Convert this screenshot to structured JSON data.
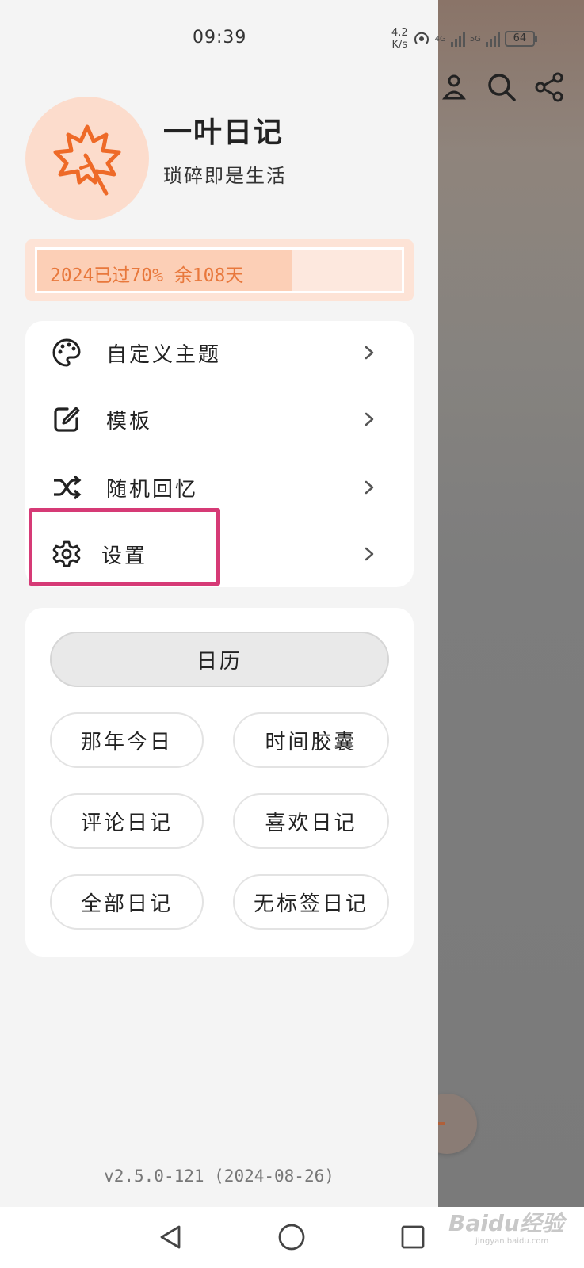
{
  "status_bar": {
    "time": "09:39",
    "speed_value": "4.2",
    "speed_unit": "K/s",
    "net1": "4G",
    "net2": "5G",
    "battery": "64"
  },
  "app": {
    "title": "一叶日记",
    "subtitle": "琐碎即是生活"
  },
  "year_progress": {
    "text": "2024已过70% 余108天",
    "fraction": 0.7
  },
  "menu": {
    "items": [
      {
        "label": "自定义主题",
        "icon": "palette-icon"
      },
      {
        "label": "模板",
        "icon": "edit-icon"
      },
      {
        "label": "随机回忆",
        "icon": "shuffle-icon"
      },
      {
        "label": "设置",
        "icon": "gear-icon"
      }
    ],
    "highlight_color": "#d63a76"
  },
  "buttons": {
    "calendar": "日历",
    "on_this_day": "那年今日",
    "time_capsule": "时间胶囊",
    "commented": "评论日记",
    "liked": "喜欢日记",
    "all": "全部日记",
    "untagged": "无标签日记"
  },
  "version": "v2.5.0-121 (2024-08-26)",
  "watermark": {
    "brand": "Baidu经验",
    "url": "jingyan.baidu.com"
  },
  "colors": {
    "accent": "#e8783c",
    "avatar_bg": "#fcdccc",
    "progress_bg": "#fde3d6"
  }
}
